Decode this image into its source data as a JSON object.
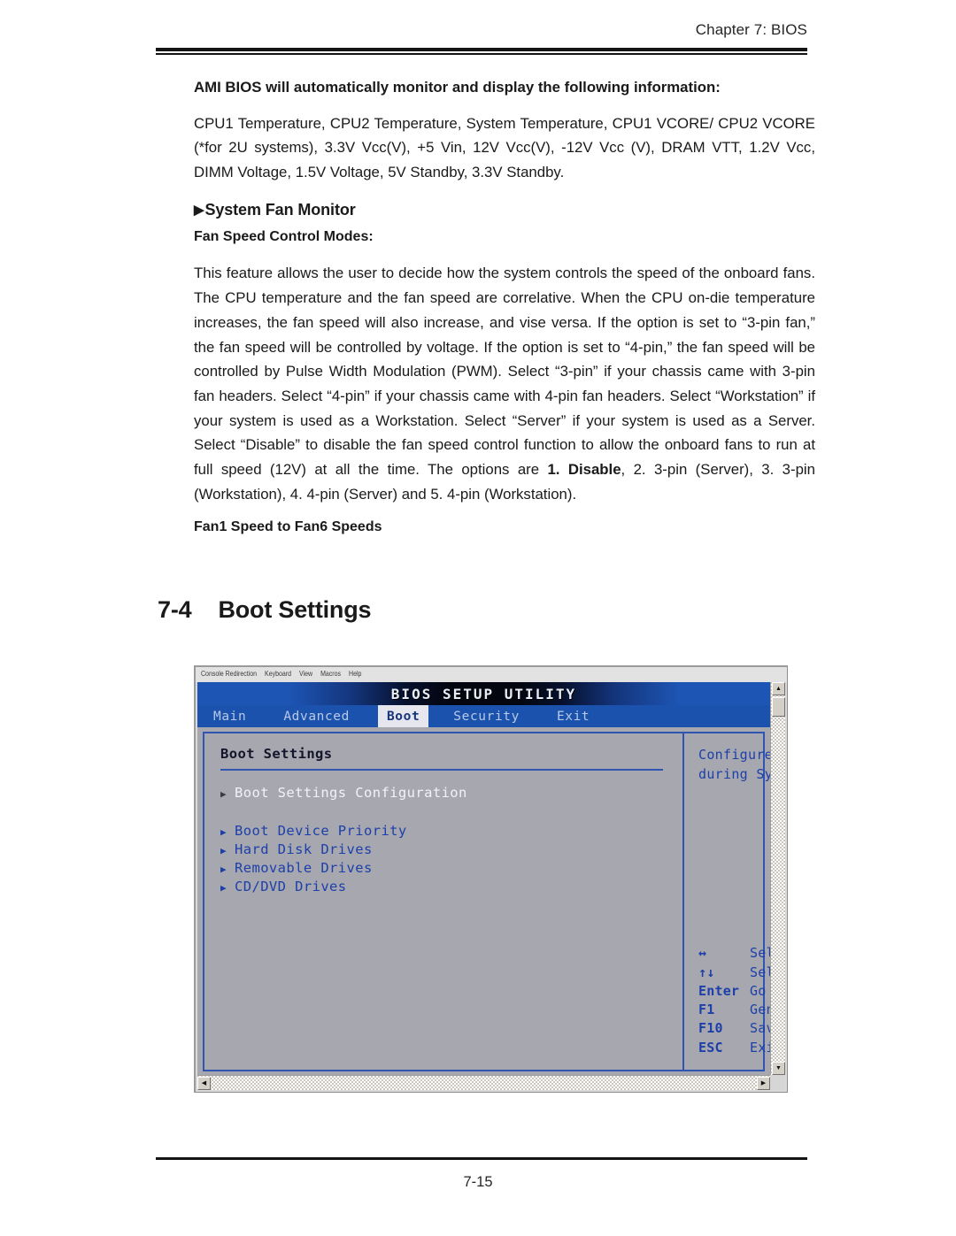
{
  "page": {
    "running_head": "Chapter 7: BIOS",
    "folio": "7-15"
  },
  "body": {
    "lead": "AMI BIOS will automatically monitor and display the following information:",
    "monitored_items_paragraph": "CPU1 Temperature, CPU2 Temperature, System Temperature, CPU1 VCORE/ CPU2 VCORE (*for 2U systems), 3.3V Vcc(V), +5 Vin, 12V Vcc(V), -12V Vcc (V), DRAM VTT, 1.2V Vcc, DIMM Voltage, 1.5V Voltage, 5V Standby, 3.3V Standby.",
    "system_fan_monitor_heading": "System Fan Monitor",
    "fan_speed_control_modes_heading": "Fan Speed Control Modes:",
    "fan_speed_paragraph_part1": "This feature allows the user to decide how the system controls the speed of the onboard fans. The CPU temperature and the fan speed are correlative. When the CPU on-die temperature increases, the fan speed will also increase, and vise versa. If the option is set to “3-pin fan,” the fan speed will be controlled by voltage.  If the option is set to “4-pin,” the fan speed will be controlled by Pulse Width Modulation (PWM). Select “3-pin” if your chassis came with 3-pin fan headers. Select “4-pin” if your chassis came with 4-pin fan headers.  Select “Workstation” if your system is used as a Workstation. Select “Server” if your system  is used as a Server. Select “Disable” to disable  the fan speed control function to allow the onboard fans to run at full speed (12V) at all the time.  The options are ",
    "fan_speed_option_bold": "1. Disable",
    "fan_speed_paragraph_part2": ",  2. 3-pin (Server), 3. 3-pin (Workstation),  4. 4-pin (Server) and 5. 4-pin (Workstation).",
    "fan_speeds_heading": "Fan1 Speed to Fan6 Speeds",
    "section_number": "7-4",
    "section_title": "Boot Settings"
  },
  "screenshot": {
    "app_menu": [
      "Console Redirection",
      "Keyboard",
      "View",
      "Macros",
      "Help"
    ],
    "bios": {
      "title": "BIOS SETUP UTILITY",
      "tabs": [
        {
          "label": "Main",
          "active": false
        },
        {
          "label": "Advanced",
          "active": false
        },
        {
          "label": "Boot",
          "active": true
        },
        {
          "label": "Security",
          "active": false
        },
        {
          "label": "Exit",
          "active": false
        }
      ],
      "pane_title": "Boot Settings",
      "menu_items": [
        {
          "label": "Boot Settings Configuration",
          "selected": true
        },
        {
          "label": "Boot Device Priority",
          "selected": false
        },
        {
          "label": "Hard Disk Drives",
          "selected": false
        },
        {
          "label": "Removable Drives",
          "selected": false
        },
        {
          "label": "CD/DVD Drives",
          "selected": false
        }
      ],
      "help_lines": [
        "Configure Settings",
        "during System Boot."
      ],
      "legend": [
        {
          "key": "↔",
          "action": "Select Screen"
        },
        {
          "key": "↑↓",
          "action": "Select Item"
        },
        {
          "key": "Enter",
          "action": "Go to Sub Screen"
        },
        {
          "key": "F1",
          "action": "General Help"
        },
        {
          "key": "F10",
          "action": "Save and Exit"
        },
        {
          "key": "ESC",
          "action": "Exit"
        }
      ],
      "colors": {
        "title_bar_blue": "#1d55b4",
        "tab_bar_blue": "#1b52ad",
        "panel_gray": "#a7a7b0",
        "text_blue": "#1d3fa8",
        "frame_blue": "#2f55b0"
      }
    },
    "scrollbars": {
      "up_arrow": "▲",
      "down_arrow": "▼",
      "left_arrow": "◀",
      "right_arrow": "▶"
    }
  }
}
